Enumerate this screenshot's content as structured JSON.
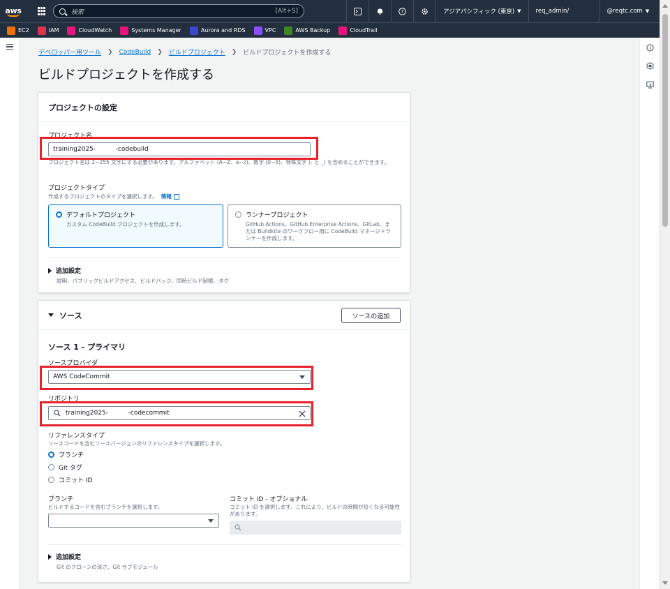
{
  "topnav": {
    "logo": "aws",
    "search_placeholder": "検索",
    "search_shortcut": "[Alt+S]",
    "region": "アジアパシフィック (東京)",
    "user": "req_admin/",
    "account": "@reqtc.com"
  },
  "favorites": [
    {
      "label": "EC2",
      "color": "#ed7100"
    },
    {
      "label": "IAM",
      "color": "#dd344c"
    },
    {
      "label": "CloudWatch",
      "color": "#e7157b"
    },
    {
      "label": "Systems Manager",
      "color": "#e7157b"
    },
    {
      "label": "Aurora and RDS",
      "color": "#3b48cc"
    },
    {
      "label": "VPC",
      "color": "#8c4fff"
    },
    {
      "label": "AWS Backup",
      "color": "#3f8624"
    },
    {
      "label": "CloudTrail",
      "color": "#e7157b"
    }
  ],
  "breadcrumb": {
    "items": [
      "デベロッパー用ツール",
      "CodeBuild",
      "ビルドプロジェクト"
    ],
    "current": "ビルドプロジェクトを作成する"
  },
  "page_title": "ビルドプロジェクトを作成する",
  "project_settings": {
    "header": "プロジェクトの設定",
    "name_label": "プロジェクト名",
    "name_value": "training2025-          -codebuild",
    "name_hint": "プロジェクト名は 2~255 文字にする必要があります。アルファベット (A~Z、a~z)、数字 (0~9)、特殊文字 (- と _) を含めることができます。",
    "type_label": "プロジェクトタイプ",
    "type_desc": "作成するプロジェクトのタイプを選択します。",
    "info_link": "情報",
    "default_title": "デフォルトプロジェクト",
    "default_desc": "カスタム CodeBuild プロジェクトを作成します。",
    "runner_title": "ランナープロジェクト",
    "runner_desc": "GitHub Actions、GitHub Enterprise Actions、GitLab、または Buildkite のワークフロー用に CodeBuild マネージドランナーを作成します。",
    "additional_title": "追加設定",
    "additional_desc": "説明、パブリックビルドアクセス、ビルドバッジ、同時ビルド制限、タグ"
  },
  "source": {
    "header": "ソース",
    "add_button": "ソースの追加",
    "section_title": "ソース 1 - プライマリ",
    "provider_label": "ソースプロバイダ",
    "provider_value": "AWS CodeCommit",
    "repo_label": "リポジトリ",
    "repo_value": "training2025-          -codecommit",
    "ref_type_label": "リファレンスタイプ",
    "ref_type_desc": "ソースコードを含むソースバージョンのリファレンスタイプを選択します。",
    "ref_options": [
      "ブランチ",
      "Git タグ",
      "コミット ID"
    ],
    "ref_selected": "ブランチ",
    "branch_label": "ブランチ",
    "branch_desc": "ビルドするコードを含むブランチを選択します。",
    "commit_label": "コミット ID - オプショナル",
    "commit_desc": "コミット ID を選択します。これにより、ビルドの時間が短くなる可能性があります。",
    "additional_title": "追加設定",
    "additional_desc": "Git のクローンの深さ、Git サブモジュール"
  }
}
